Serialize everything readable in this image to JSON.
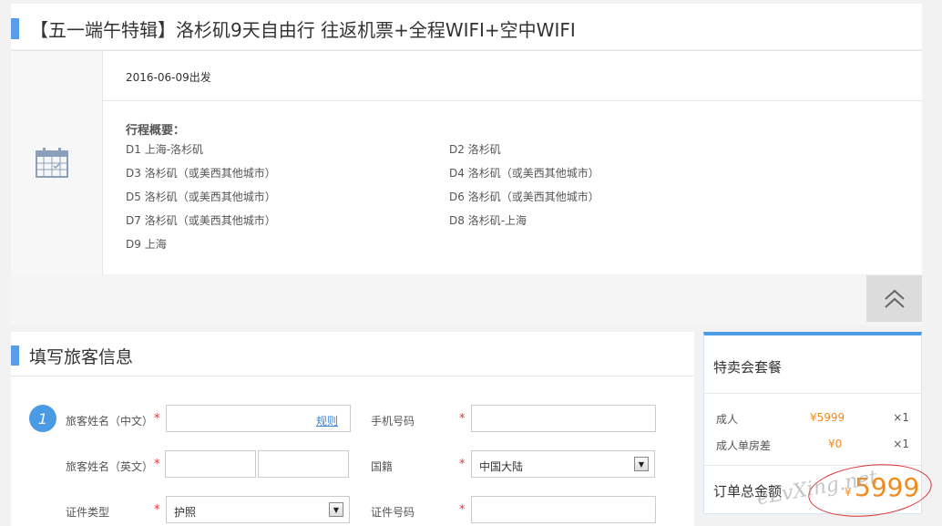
{
  "header": {
    "title": "【五一端午特辑】洛杉矶9天自由行 往返机票+全程WIFI+空中WIFI"
  },
  "trip": {
    "depart": "2016-06-09出发",
    "overview_title": "行程概要：",
    "days": [
      "D1 上海-洛杉矶",
      "D2 洛杉矶",
      "D3 洛杉矶（或美西其他城市）",
      "D4 洛杉矶（或美西其他城市）",
      "D5 洛杉矶（或美西其他城市）",
      "D6 洛杉矶（或美西其他城市）",
      "D7 洛杉矶（或美西其他城市）",
      "D8 洛杉矶-上海",
      "D9 上海"
    ]
  },
  "form": {
    "title": "填写旅客信息",
    "step": "1",
    "name_cn_label": "旅客姓名（中文）",
    "rule_link": "规则",
    "phone_label": "手机号码",
    "name_en_label": "旅客姓名（英文）",
    "nationality_label": "国籍",
    "nationality_value": "中国大陆",
    "id_type_label": "证件类型",
    "id_type_value": "护照",
    "id_number_label": "证件号码",
    "required_mark": "*"
  },
  "summary": {
    "title": "特卖会套餐",
    "items": [
      {
        "name": "成人",
        "price": "¥5999",
        "qty": "×1"
      },
      {
        "name": "成人单房差",
        "price": "¥0",
        "qty": "×1"
      }
    ],
    "total_label": "订单总金额",
    "currency": "¥",
    "total": "5999"
  },
  "watermark": "eLvXing.net"
}
